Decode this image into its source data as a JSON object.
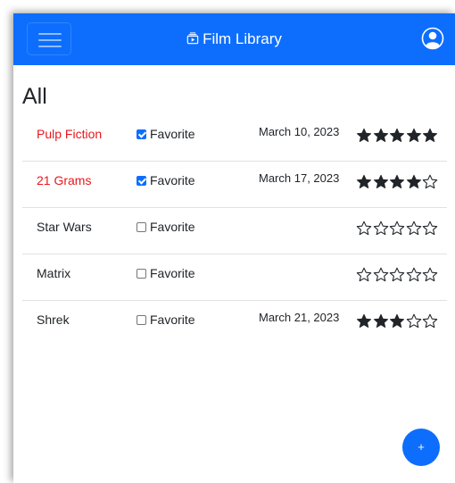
{
  "navbar": {
    "brand": "Film Library",
    "menu_icon": "hamburger-icon",
    "brand_icon": "collection-play-icon",
    "user_icon": "person-circle-icon",
    "color": "#0d6efd"
  },
  "filter": {
    "title": "All"
  },
  "films": [
    {
      "title": "Pulp Fiction",
      "favorite": true,
      "favorite_label": "Favorite",
      "date": "March 10, 2023",
      "rating": 5
    },
    {
      "title": "21 Grams",
      "favorite": true,
      "favorite_label": "Favorite",
      "date": "March 17, 2023",
      "rating": 4
    },
    {
      "title": "Star Wars",
      "favorite": false,
      "favorite_label": "Favorite",
      "date": "",
      "rating": 0
    },
    {
      "title": "Matrix",
      "favorite": false,
      "favorite_label": "Favorite",
      "date": "",
      "rating": 0
    },
    {
      "title": "Shrek",
      "favorite": false,
      "favorite_label": "Favorite",
      "date": "March 21, 2023",
      "rating": 3
    }
  ],
  "rating_max": 5,
  "favorite_color": "#e8171c",
  "add_button": {
    "label": "+",
    "color": "#0d6efd"
  }
}
